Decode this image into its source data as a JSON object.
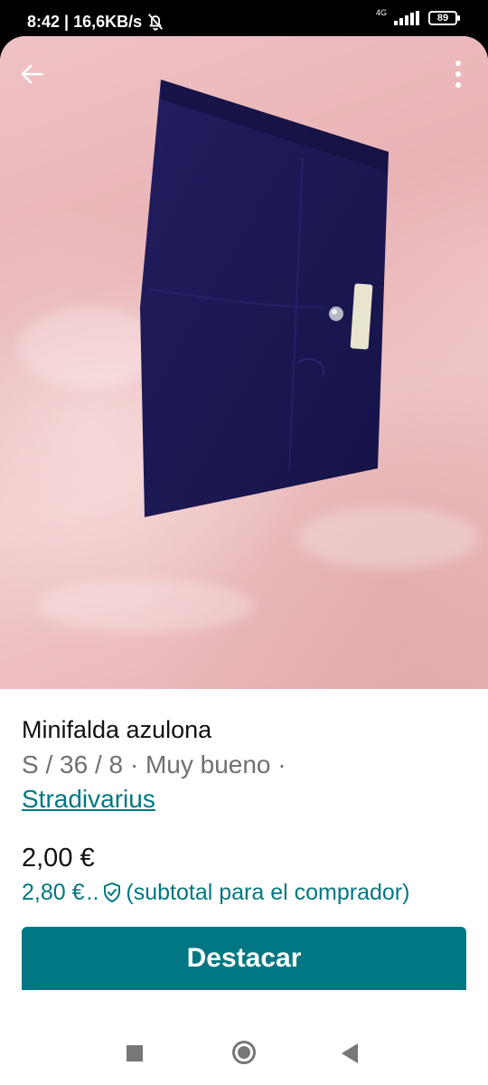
{
  "status_bar": {
    "time_speed": "8:42 | 16,6KB/s",
    "network": "4G",
    "battery": "89"
  },
  "listing": {
    "title": "Minifalda azulona",
    "meta": "S / 36 / 8 · Muy bueno ·",
    "brand": "Stradivarius",
    "price": "2,00 €",
    "buyer_price": "2,80 €",
    "buyer_ellipsis": "..",
    "buyer_note": "(subtotal para el comprador)"
  },
  "actions": {
    "feature_label": "Destacar"
  },
  "colors": {
    "accent": "#007782",
    "skirt": "#1d1a55",
    "background_photo": "#efbfc2"
  },
  "icons": {
    "back": "arrow-left-icon",
    "more": "more-vertical-icon",
    "shield": "shield-check-icon",
    "mute": "bell-off-icon"
  }
}
